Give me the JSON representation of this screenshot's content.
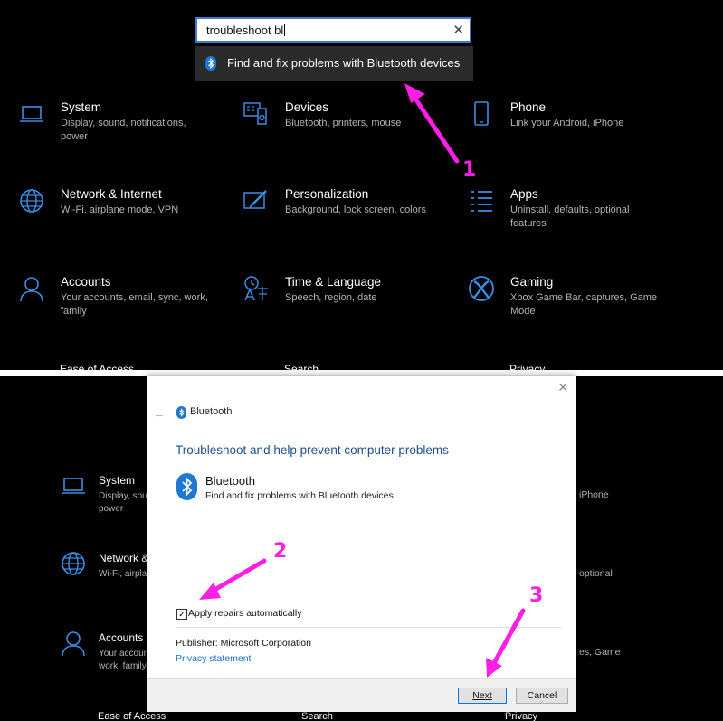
{
  "search": {
    "value": "troubleshoot bl",
    "result_label": "Find and fix problems with Bluetooth devices"
  },
  "top_tiles": [
    {
      "title": "System",
      "desc": "Display, sound, notifications, power",
      "icon": "laptop-icon"
    },
    {
      "title": "Devices",
      "desc": "Bluetooth, printers, mouse",
      "icon": "devices-icon"
    },
    {
      "title": "Phone",
      "desc": "Link your Android, iPhone",
      "icon": "phone-icon"
    },
    {
      "title": "Network & Internet",
      "desc": "Wi-Fi, airplane mode, VPN",
      "icon": "globe-icon"
    },
    {
      "title": "Personalization",
      "desc": "Background, lock screen, colors",
      "icon": "paintbrush-icon"
    },
    {
      "title": "Apps",
      "desc": "Uninstall, defaults, optional features",
      "icon": "apps-list-icon"
    },
    {
      "title": "Accounts",
      "desc": "Your accounts, email, sync, work, family",
      "icon": "person-icon"
    },
    {
      "title": "Time & Language",
      "desc": "Speech, region, date",
      "icon": "time-language-icon"
    },
    {
      "title": "Gaming",
      "desc": "Xbox Game Bar, captures, Game Mode",
      "icon": "xbox-icon"
    }
  ],
  "top_clipped": [
    "Ease of Access",
    "Search",
    "Privacy"
  ],
  "bottom_tiles": [
    {
      "title": "System",
      "desc": "Display, sou",
      "desc2": "power"
    },
    {
      "title": "Network &",
      "desc": "Wi-Fi, airpla"
    },
    {
      "title": "Accounts",
      "desc": "Your accoun",
      "desc2": "work, family"
    }
  ],
  "bottom_right_partials": [
    "iPhone",
    "optional",
    "es, Game"
  ],
  "bottom_clipped": [
    "Ease of Access",
    "Search",
    "Privacy"
  ],
  "dialog": {
    "header": "Bluetooth",
    "heading": "Troubleshoot and help prevent computer problems",
    "item_title": "Bluetooth",
    "item_sub": "Find and fix problems with Bluetooth devices",
    "checkbox_label": "Apply repairs automatically",
    "publisher": "Publisher:  Microsoft Corporation",
    "privacy": "Privacy statement",
    "next": "Next",
    "cancel": "Cancel"
  },
  "annotations": [
    "1",
    "2",
    "3"
  ],
  "colors": {
    "accent_blue": "#3a8ee6",
    "annotation": "#ff1ee3",
    "link": "#1a6fc9"
  }
}
